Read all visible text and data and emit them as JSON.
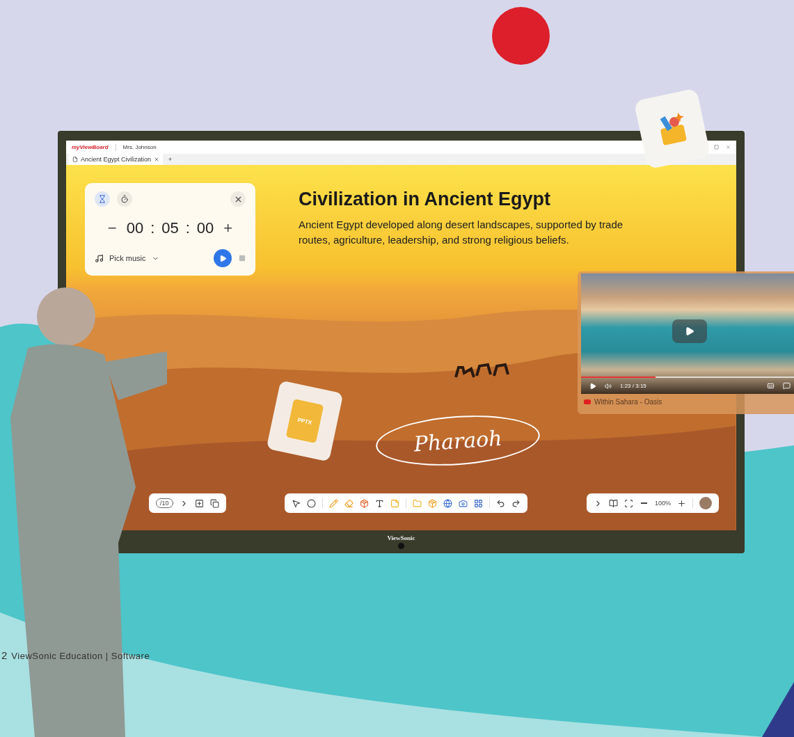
{
  "browser": {
    "logo": "myViewBoard",
    "user": "Mrs. Johnson",
    "tab": {
      "label": "Ancient Egypt Civilization",
      "selected": true
    },
    "new_tab": "+"
  },
  "timer": {
    "modes": [
      {
        "kind": "countdown",
        "selected": true
      },
      {
        "kind": "stopwatch",
        "selected": false
      }
    ],
    "minus": "−",
    "hours": "00",
    "minutes": "05",
    "seconds": "00",
    "separator": ":",
    "plus": "+",
    "music": "Pick music"
  },
  "slide": {
    "title": "Civilization in Ancient Egypt",
    "body": "Ancient Egypt developed along desert landscapes, supported by trade routes, agriculture, leadership, and strong religious beliefs."
  },
  "pptx_label": "PPTX",
  "signature": "Pharaoh",
  "page_toolbar": {
    "counter": "/10"
  },
  "zoom_toolbar": {
    "zoom": "100%"
  },
  "video": {
    "time": "1:23 / 3:15",
    "level": 0.34,
    "title": "Within Sahara - Oasis"
  },
  "bezel": {
    "brand": "ViewSonic"
  },
  "footer": {
    "page": "2",
    "text": "ViewSonic Education | Software"
  }
}
